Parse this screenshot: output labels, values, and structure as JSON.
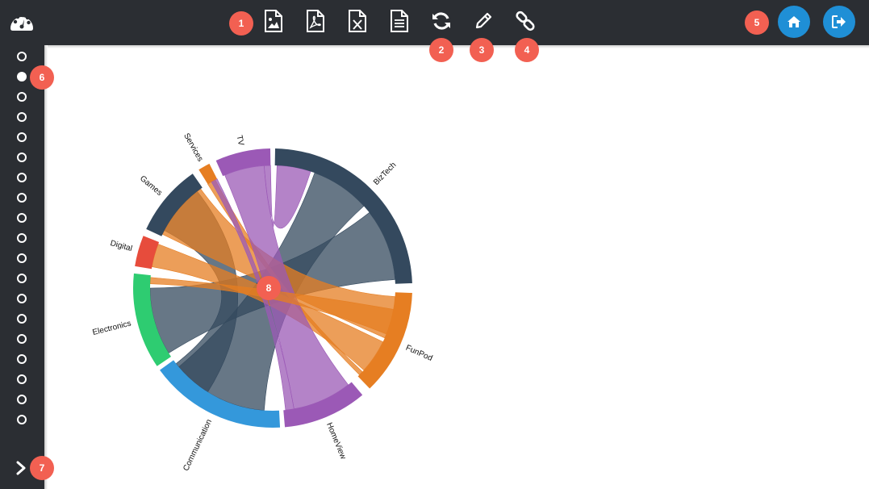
{
  "toolbar": {
    "tools": [
      {
        "name": "export-image",
        "icon": "image-file-icon"
      },
      {
        "name": "export-pdf",
        "icon": "pdf-file-icon"
      },
      {
        "name": "export-excel",
        "icon": "excel-file-icon"
      },
      {
        "name": "export-text",
        "icon": "text-file-icon"
      },
      {
        "name": "refresh",
        "icon": "refresh-icon"
      },
      {
        "name": "edit",
        "icon": "pencil-icon"
      },
      {
        "name": "link",
        "icon": "link-icon"
      }
    ],
    "right_buttons": [
      {
        "name": "home",
        "icon": "home-icon"
      },
      {
        "name": "logout",
        "icon": "logout-icon"
      }
    ],
    "accent": "#1f8fd6"
  },
  "sidebar": {
    "slide_count": 19,
    "active_index": 1,
    "expand_icon": "chevron-right-icon"
  },
  "badges": [
    "1",
    "2",
    "3",
    "4",
    "5",
    "6",
    "7",
    "8"
  ],
  "chart_data": {
    "type": "chord",
    "groups": [
      {
        "label": "BizTech",
        "color": "#34495e"
      },
      {
        "label": "FunPod",
        "color": "#e67e22"
      },
      {
        "label": "HomeView",
        "color": "#9b59b6"
      },
      {
        "label": "Communication",
        "color": "#3498db"
      },
      {
        "label": "Electronics",
        "color": "#2ecc71"
      },
      {
        "label": "Digital",
        "color": "#e74c3c"
      },
      {
        "label": "Games",
        "color": "#34495e"
      },
      {
        "label": "Services",
        "color": "#e67e22"
      },
      {
        "label": "TV",
        "color": "#9b59b6"
      }
    ]
  }
}
